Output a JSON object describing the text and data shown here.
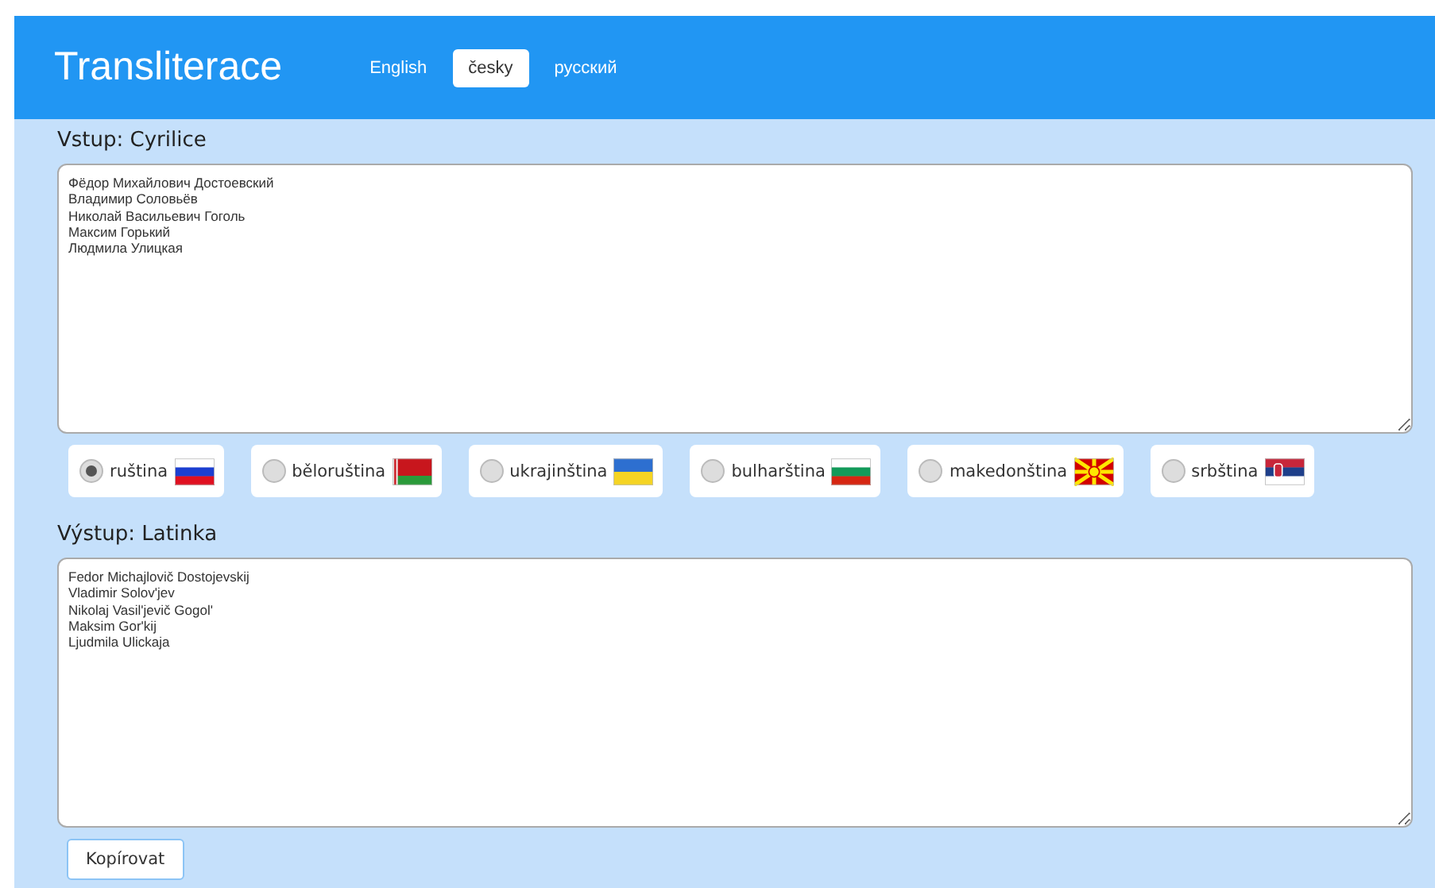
{
  "header": {
    "title": "Transliterace",
    "tabs": [
      {
        "label": "English",
        "selected": false
      },
      {
        "label": "česky",
        "selected": true
      },
      {
        "label": "русский",
        "selected": false
      }
    ]
  },
  "input": {
    "label": "Vstup: Cyrilice",
    "value": "Фёдор Михайлович Достоевский\nВладимир Соловьёв\nНиколай Васильевич Гоголь\nМаксим Горький\nЛюдмила Улицкая"
  },
  "languages": [
    {
      "label": "ruština",
      "selected": true,
      "kind": "ru"
    },
    {
      "label": "běloruština",
      "selected": false,
      "kind": "by"
    },
    {
      "label": "ukrajinština",
      "selected": false,
      "kind": "ua"
    },
    {
      "label": "bulharština",
      "selected": false,
      "kind": "bg"
    },
    {
      "label": "makedonština",
      "selected": false,
      "kind": "mk"
    },
    {
      "label": "srbština",
      "selected": false,
      "kind": "rs"
    }
  ],
  "output": {
    "label": "Výstup: Latinka",
    "value": "Fedor Michajlovič Dostojevskij\nVladimir Solov'jev\nNikolaj Vasil'jevič Gogol'\nMaksim Gor'kij\nLjudmila Ulickaja"
  },
  "copy_button": "Kopírovat"
}
